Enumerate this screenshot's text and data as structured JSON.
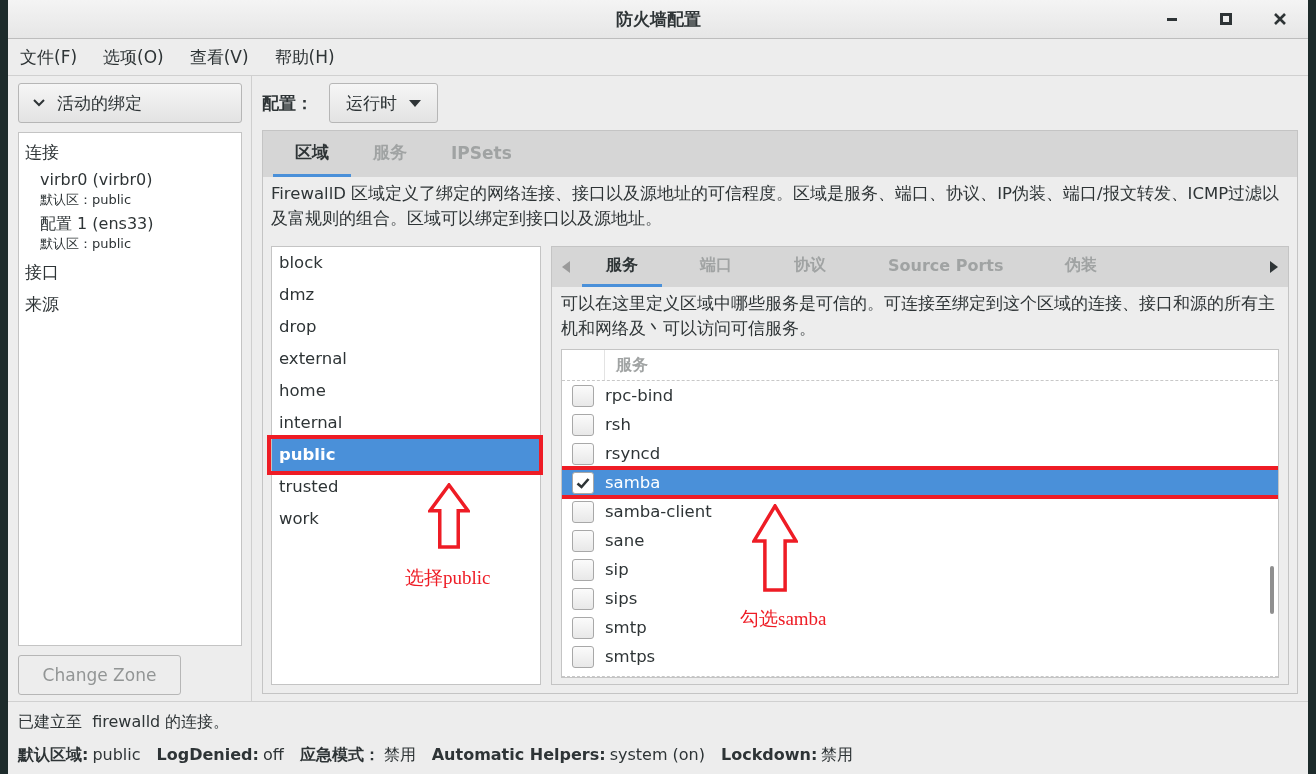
{
  "window": {
    "title": "防火墙配置"
  },
  "menu": [
    "文件(F)",
    "选项(O)",
    "查看(V)",
    "帮助(H)"
  ],
  "bindings": {
    "toggle": "活动的绑定",
    "expanded": true,
    "groups": [
      {
        "label": "连接",
        "children": [
          {
            "label": "virbr0 (virbr0)",
            "detail": "默认区：public"
          },
          {
            "label": "配置 1 (ens33)",
            "detail": "默认区：public"
          }
        ]
      },
      {
        "label": "接口"
      },
      {
        "label": "来源"
      }
    ]
  },
  "change_zone_button": {
    "label": "Change Zone",
    "disabled": true
  },
  "configuration": {
    "label": "配置：",
    "value": "运行时"
  },
  "tabs": [
    {
      "label": "区域",
      "selected": true
    },
    {
      "label": "服务",
      "selected": false
    },
    {
      "label": "IPSets",
      "selected": false
    }
  ],
  "zone_description": "FirewallD 区域定义了绑定的网络连接、接口以及源地址的可信程度。区域是服务、端口、协议、IP伪装、端口/报文转发、ICMP过滤以及富规则的组合。区域可以绑定到接口以及源地址。",
  "zones": [
    {
      "name": "block",
      "selected": false
    },
    {
      "name": "dmz",
      "selected": false
    },
    {
      "name": "drop",
      "selected": false
    },
    {
      "name": "external",
      "selected": false
    },
    {
      "name": "home",
      "selected": false
    },
    {
      "name": "internal",
      "selected": false
    },
    {
      "name": "public",
      "selected": true
    },
    {
      "name": "trusted",
      "selected": false
    },
    {
      "name": "work",
      "selected": false
    }
  ],
  "zone_tabs": [
    {
      "label": "服务",
      "selected": true
    },
    {
      "label": "端口",
      "selected": false
    },
    {
      "label": "协议",
      "selected": false
    },
    {
      "label": "Source Ports",
      "selected": false
    },
    {
      "label": "伪装",
      "selected": false
    }
  ],
  "services_description": "可以在这里定义区域中哪些服务是可信的。可连接至绑定到这个区域的连接、接口和源的所有主机和网络及丶可以访问可信服务。",
  "services_table": {
    "columns": [
      "服务"
    ],
    "rows": [
      {
        "name": "rpc-bind",
        "checked": false,
        "selected": false
      },
      {
        "name": "rsh",
        "checked": false,
        "selected": false
      },
      {
        "name": "rsyncd",
        "checked": false,
        "selected": false
      },
      {
        "name": "samba",
        "checked": true,
        "selected": true
      },
      {
        "name": "samba-client",
        "checked": false,
        "selected": false
      },
      {
        "name": "sane",
        "checked": false,
        "selected": false
      },
      {
        "name": "sip",
        "checked": false,
        "selected": false
      },
      {
        "name": "sips",
        "checked": false,
        "selected": false
      },
      {
        "name": "smtp",
        "checked": false,
        "selected": false
      },
      {
        "name": "smtps",
        "checked": false,
        "selected": false
      }
    ]
  },
  "status": {
    "message": "已建立至  firewalld 的连接。",
    "fields": [
      {
        "label": "默认区域:",
        "value": "public"
      },
      {
        "label": "LogDenied:",
        "value": "off"
      },
      {
        "label": "应急模式：",
        "value": "禁用"
      },
      {
        "label": "Automatic Helpers:",
        "value": "system (on)"
      },
      {
        "label": "Lockdown:",
        "value": "禁用"
      }
    ]
  },
  "annotations": [
    {
      "kind": "zone",
      "text": "选择public"
    },
    {
      "kind": "service",
      "text": "勾选samba"
    }
  ]
}
